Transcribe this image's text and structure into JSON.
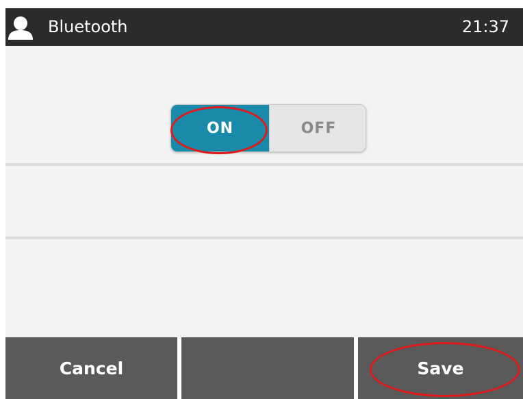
{
  "header": {
    "avatar_icon": "user-avatar-icon",
    "title": "Bluetooth",
    "time": "21:37"
  },
  "toggle": {
    "on_label": "ON",
    "off_label": "OFF",
    "selected": "ON"
  },
  "softkeys": {
    "cancel_label": "Cancel",
    "middle_label": "",
    "save_label": "Save"
  },
  "colors": {
    "topbar_bg": "#2b2b2b",
    "toggle_on_bg": "#1a8aaa",
    "softkey_bg": "#5a5a5b",
    "annotation": "#e01a1a"
  }
}
